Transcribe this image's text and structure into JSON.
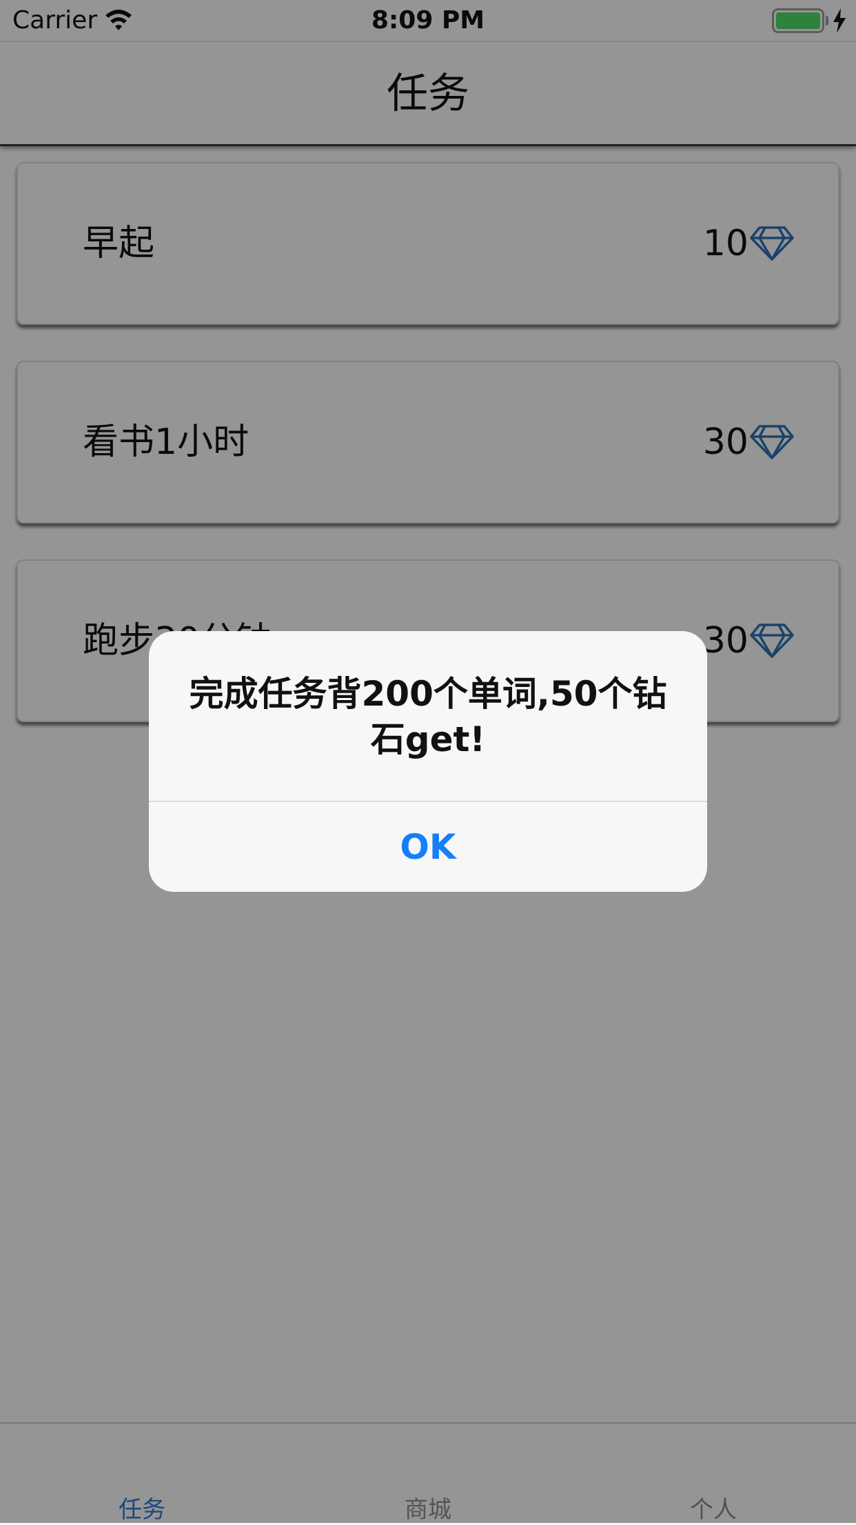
{
  "status_bar": {
    "carrier": "Carrier",
    "time": "8:09 PM",
    "battery_level": 1.0,
    "battery_color": "#4cd964",
    "icons": [
      "wifi-icon",
      "battery-icon",
      "charging-bolt-icon"
    ]
  },
  "nav": {
    "title": "任务"
  },
  "tasks": [
    {
      "name": "早起",
      "reward": "10",
      "icon": "diamond-icon"
    },
    {
      "name": "看书1小时",
      "reward": "30",
      "icon": "diamond-icon"
    },
    {
      "name": "跑步30分钟",
      "reward": "30",
      "icon": "diamond-icon"
    }
  ],
  "alert": {
    "message": "完成任务背200个单词,50个钻石get!",
    "ok_label": "OK",
    "ok_color": "#157efb"
  },
  "tabs": [
    {
      "label": "任务",
      "active": true
    },
    {
      "label": "商城",
      "active": false
    },
    {
      "label": "个人",
      "active": false
    }
  ],
  "colors": {
    "accent": "#2d79d3",
    "diamond": "#2f6fb3"
  }
}
